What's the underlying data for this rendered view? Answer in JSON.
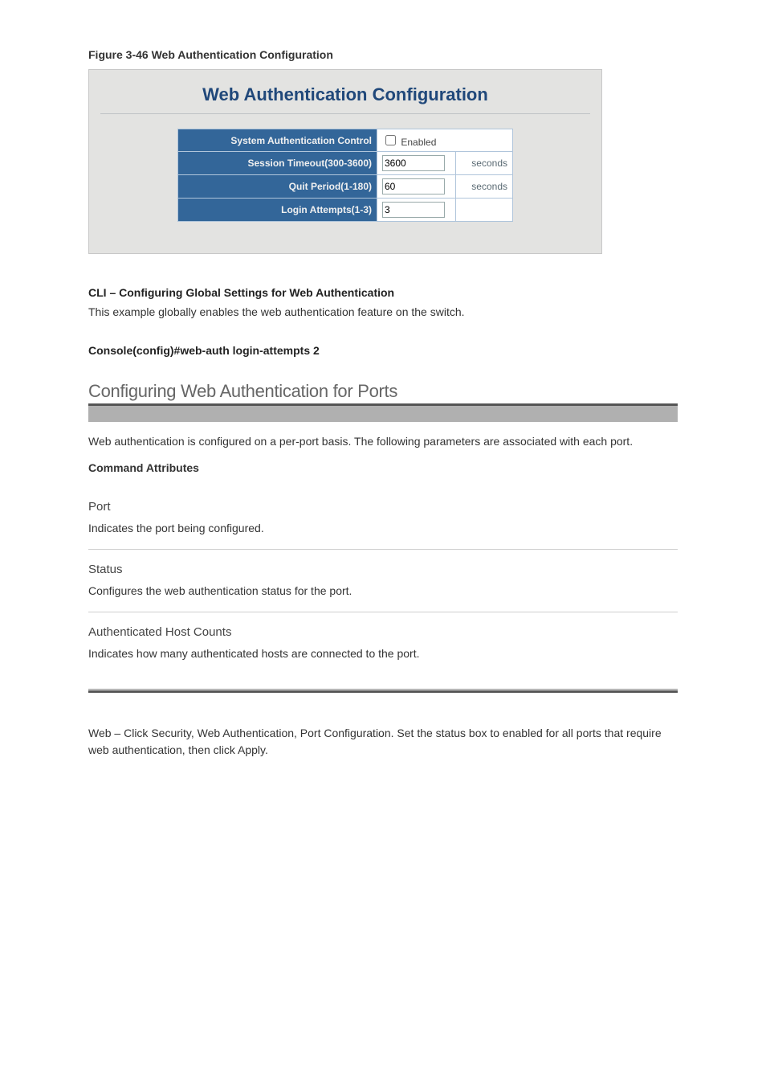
{
  "figure_label": "Figure 3-46   Web Authentication Configuration",
  "panel": {
    "title": "Web Authentication Configuration",
    "rows": {
      "sys_auth_ctrl": {
        "label": "System Authentication Control",
        "checkbox_label": "Enabled"
      },
      "session_timeout": {
        "label": "Session Timeout(300-3600)",
        "value": "3600",
        "unit": "seconds"
      },
      "quit_period": {
        "label": "Quit Period(1-180)",
        "value": "60",
        "unit": "seconds"
      },
      "login_attempts": {
        "label": "Login Attempts(1-3)",
        "value": "3",
        "unit": ""
      }
    }
  },
  "cli_section": {
    "heading": "CLI – Configuring Global Settings for Web Authentication",
    "text": "This example globally enables the web authentication feature on the switch.",
    "heading2": "Console(config)#web-auth login-attempts 2"
  },
  "port_section": {
    "title": "Configuring Web Authentication for Ports",
    "intro": "Web authentication is configured on a per-port basis. The following parameters are associated with each port.",
    "params_label": "Command Attributes",
    "params": [
      {
        "name": "Port",
        "desc": "Indicates the port being configured."
      },
      {
        "name": "Status",
        "desc": "Configures the web authentication status for the port."
      },
      {
        "name": "Authenticated Host Counts",
        "desc": "Indicates how many authenticated hosts are connected to the port."
      }
    ],
    "footer": "Web – Click Security, Web Authentication, Port Configuration.  Set the status box to enabled for all ports that require web authentication, then click Apply."
  }
}
